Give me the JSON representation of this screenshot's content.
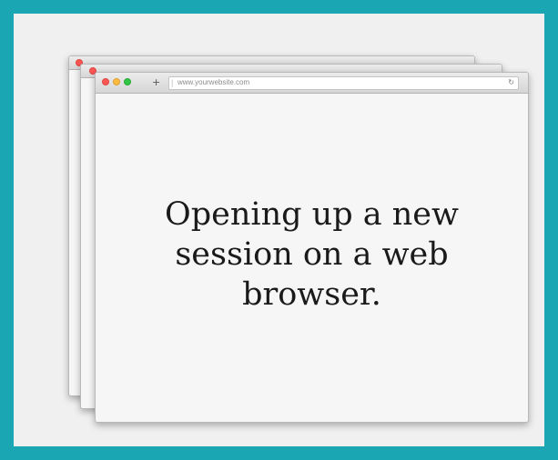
{
  "browser": {
    "url": "www.yourwebsite.com",
    "new_tab_symbol": "+",
    "url_separator": "|",
    "reload_symbol": "↻",
    "buttons": [
      "red-close-icon",
      "yellow-minimize-icon",
      "green-zoom-icon"
    ]
  },
  "caption": "Opening up a new session on a web browser.",
  "colors": {
    "frame_border": "#1ba6b3",
    "frame_background": "#f0f0f0",
    "window_background": "#f6f6f6"
  }
}
